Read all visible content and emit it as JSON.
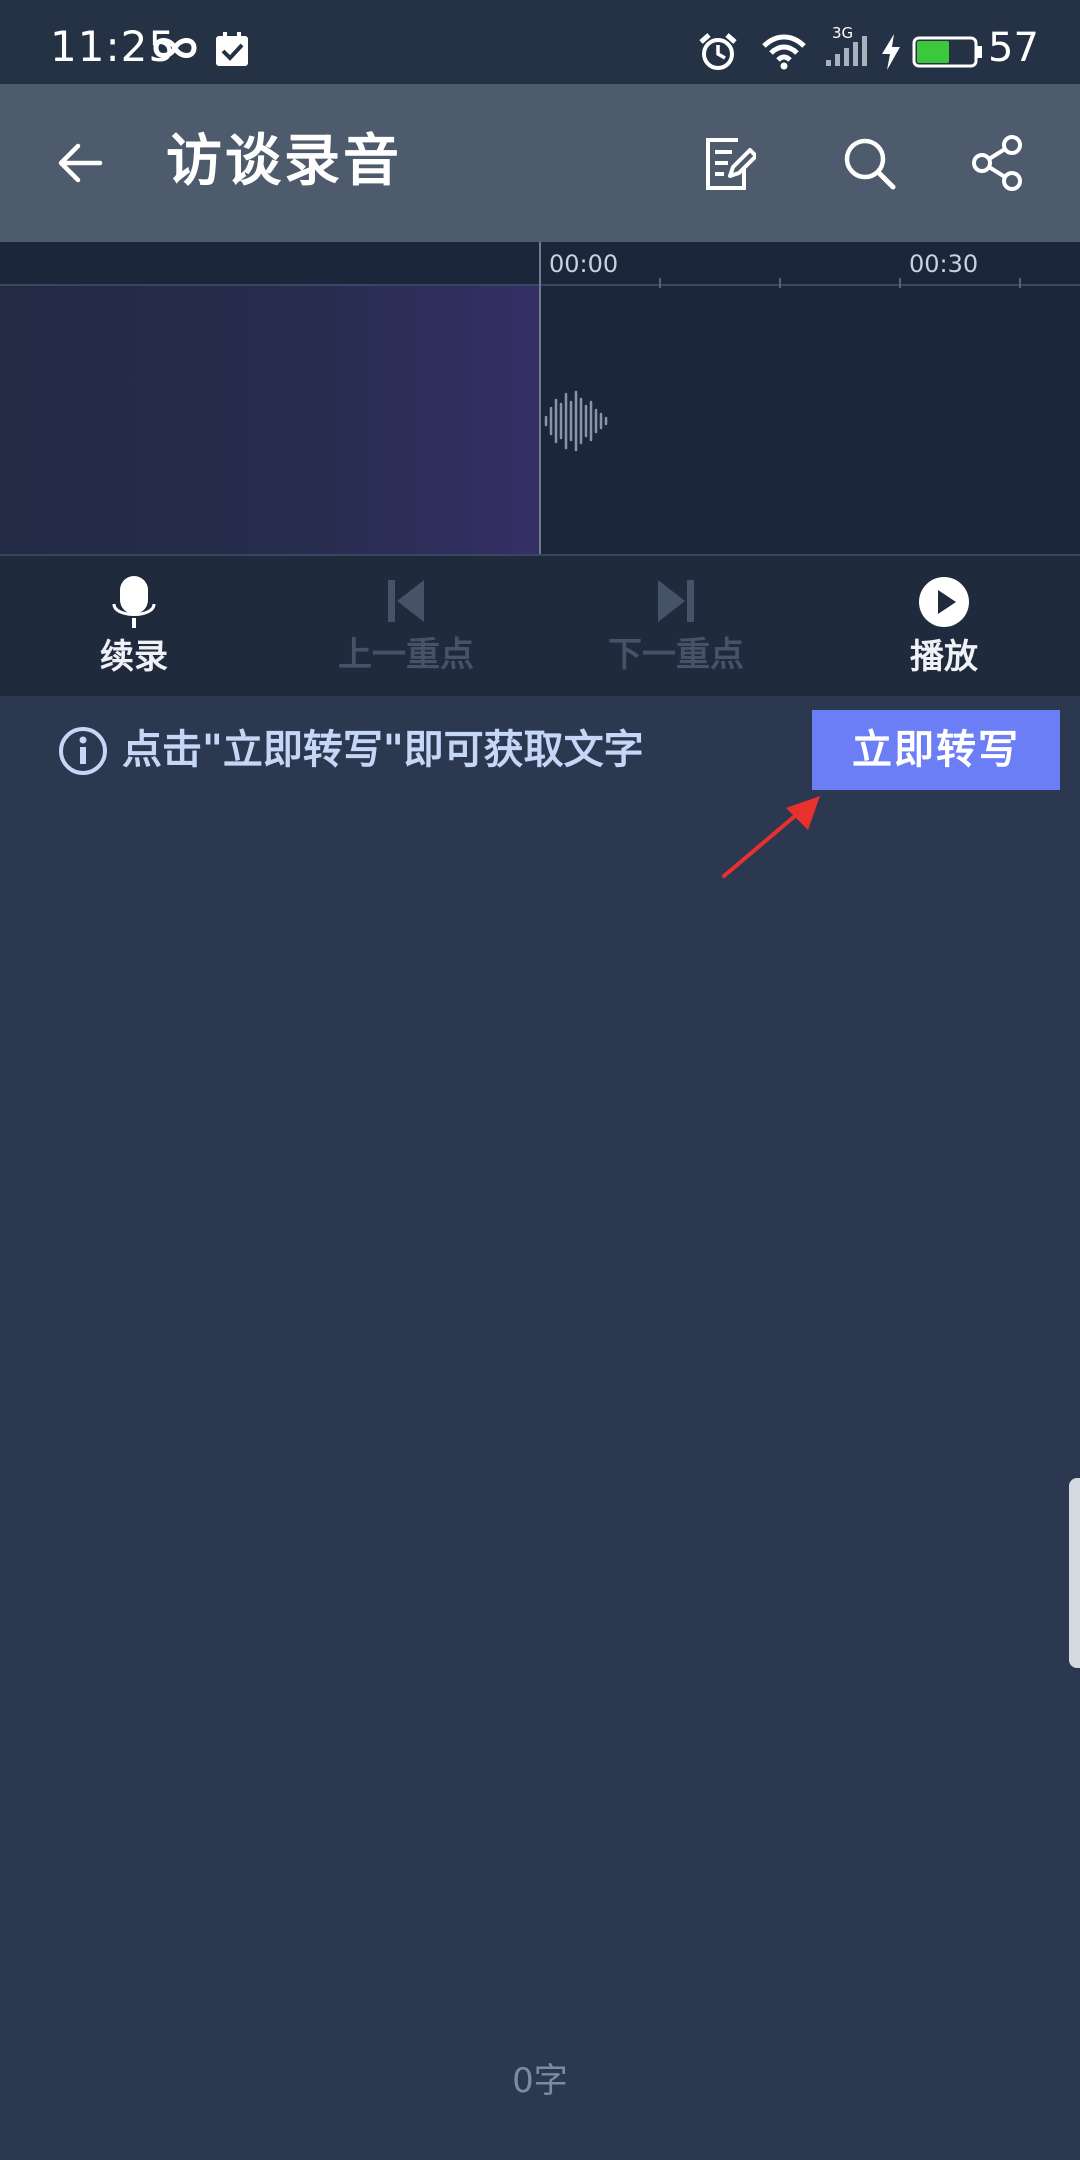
{
  "status_bar": {
    "time": "11:25",
    "network_type": "3G",
    "battery_level": "57",
    "battery_fraction": 0.57,
    "icons": [
      "infinity-icon",
      "task-check-icon",
      "alarm-icon",
      "wifi-icon",
      "signal-icon",
      "charging-bolt-icon",
      "battery-icon"
    ]
  },
  "app_bar": {
    "title": "访谈录音",
    "icons": [
      "back-arrow-icon",
      "edit-note-icon",
      "search-icon",
      "share-icon"
    ]
  },
  "timeline": {
    "marks": [
      "00:00",
      "00:30"
    ]
  },
  "controls": {
    "record": {
      "label": "续录",
      "icon": "microphone-icon",
      "enabled": true
    },
    "prev_highlight": {
      "label": "上一重点",
      "icon": "skip-previous-icon",
      "enabled": false
    },
    "next_highlight": {
      "label": "下一重点",
      "icon": "skip-next-icon",
      "enabled": false
    },
    "play": {
      "label": "播放",
      "icon": "play-circle-icon",
      "enabled": true
    }
  },
  "hint": {
    "icon": "info-icon",
    "text": "点击\"立即转写\"即可获取文字"
  },
  "transcribe_button": {
    "label": "立即转写"
  },
  "footer": {
    "word_count": "0字"
  },
  "colors": {
    "background": "#2b3850",
    "app_bar": "#4d5b6c",
    "accent_button": "#6b7ef5",
    "hint_text": "#c6d6f6",
    "annotation_arrow": "#e8312f",
    "battery_fill": "#3cc83c"
  }
}
